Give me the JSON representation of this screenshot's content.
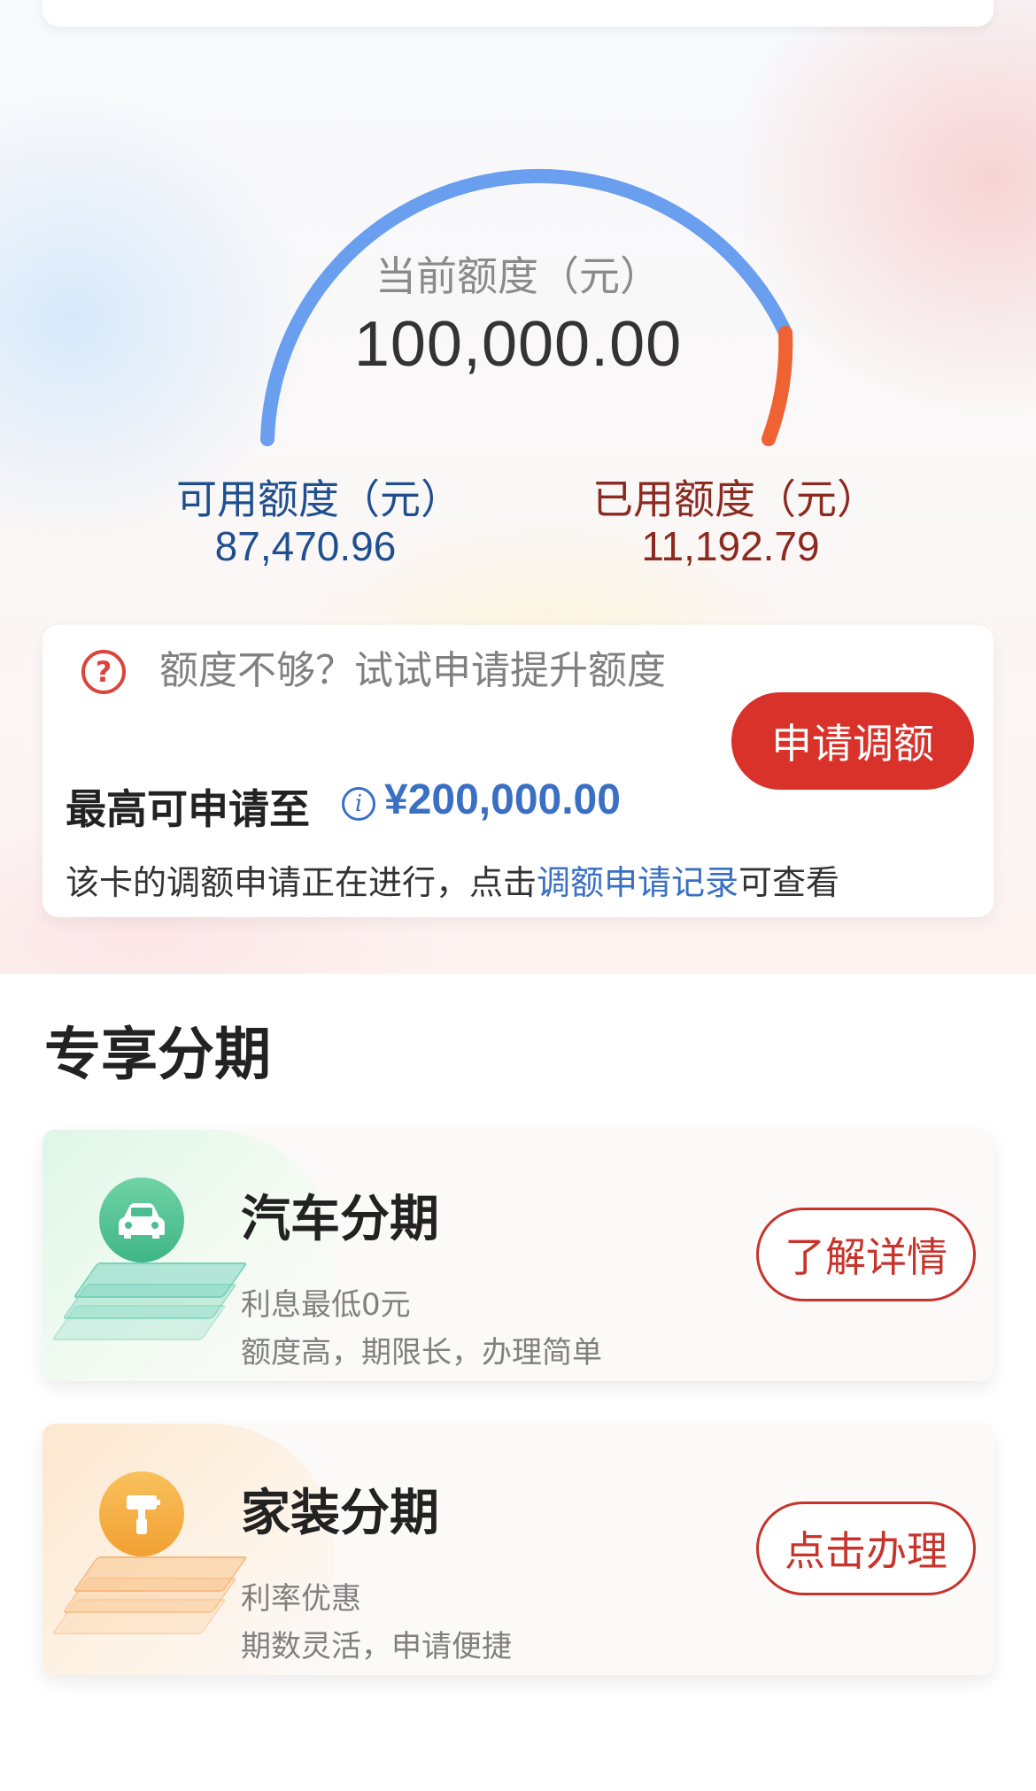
{
  "limit": {
    "current_label": "当前额度（元）",
    "current_value": "100,000.00",
    "available_label": "可用额度（元）",
    "available_value": "87,470.96",
    "used_label": "已用额度（元）",
    "used_value": "11,192.79",
    "used_fraction": 0.112,
    "colors": {
      "available_arc": "#6a9eef",
      "used_arc": "#ef6233"
    }
  },
  "apply": {
    "hint": "额度不够？试试申请提升额度",
    "max_label": "最高可申请至",
    "max_value": "¥200,000.00",
    "note_prefix": "该卡的调额申请正在进行，点击",
    "note_link": "调额申请记录",
    "note_suffix": "可查看",
    "button_label": "申请调额",
    "accent": "#d8322a"
  },
  "section": {
    "title": "专享分期"
  },
  "products": [
    {
      "title": "汽车分期",
      "line1": "利息最低0元",
      "line2": "额度高，期限长，办理简单",
      "button_label": "了解详情",
      "icon": "car-icon"
    },
    {
      "title": "家装分期",
      "line1": "利率优惠",
      "line2": "期数灵活，申请便捷",
      "button_label": "点击办理",
      "icon": "paint-roller-icon"
    }
  ]
}
